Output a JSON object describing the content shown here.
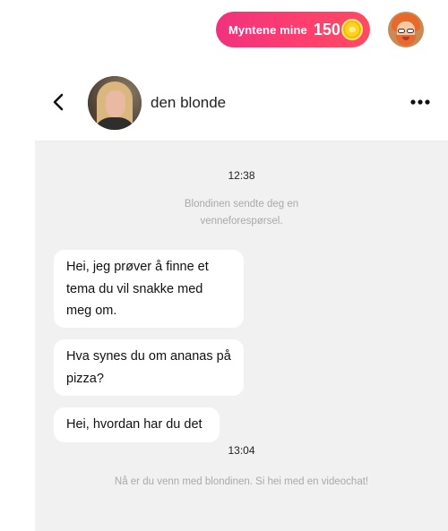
{
  "topbar": {
    "coins_label": "Myntene mine",
    "coins_count": "150"
  },
  "header": {
    "contact_name": "den blonde"
  },
  "conversation": {
    "timestamp_1": "12:38",
    "system_note_1": "Blondinen sendte deg en venneforespørsel.",
    "messages": [
      {
        "text": "Hei, jeg prøver å finne et tema du vil snakke med meg om."
      },
      {
        "text": "Hva synes du om ananas på pizza?"
      },
      {
        "text": "Hei, hvordan har du det"
      }
    ],
    "timestamp_2": "13:04",
    "system_note_2": "Nå er du venn med blondinen. Si hei med en videochat!"
  },
  "colors": {
    "coins_pill_gradient_start": "#f0327e",
    "coins_pill_gradient_end": "#ff4b62",
    "coin_yellow": "#ffd21f",
    "chat_background": "#f1f1f1",
    "bubble_background": "#ffffff",
    "system_text": "#a9a9a9"
  },
  "icons": {
    "back": "chevron-left-icon",
    "more": "more-dots-icon",
    "coin": "coin-icon"
  }
}
